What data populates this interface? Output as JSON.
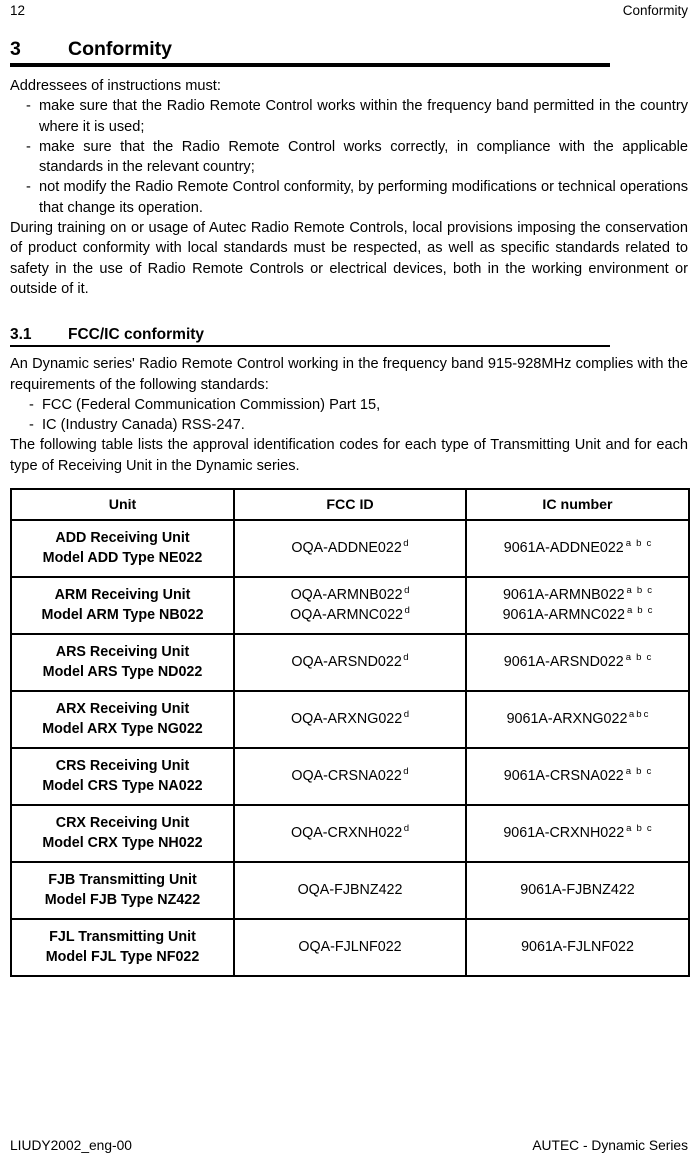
{
  "running_head": {
    "page_number": "12",
    "section_name": "Conformity"
  },
  "section_3": {
    "number": "3",
    "title": "Conformity",
    "intro": "Addressees of instructions must:",
    "bullets": [
      "make sure that the Radio Remote Control works within the frequency band permitted in the country where it is used;",
      "make sure that the Radio Remote Control works correctly, in compliance with the applicable standards in the relevant country;",
      "not modify the Radio Remote Control conformity, by performing modifications or technical operations that change its operation."
    ],
    "closing_paragraph": "During training on or usage of Autec Radio Remote Controls, local provisions imposing the conservation of product conformity with local standards must be respected, as well as specific standards related to safety in the use of Radio Remote Controls or electrical devices, both in the working environment or outside of it."
  },
  "section_3_1": {
    "number": "3.1",
    "title": "FCC/IC conformity",
    "intro": "An Dynamic series' Radio Remote Control working in the frequency band 915-928MHz complies with the requirements of the following standards:",
    "standards": [
      "FCC (Federal Communication Commission) Part 15,",
      "IC (Industry Canada) RSS-247."
    ],
    "table_lead_in": "The following table lists the approval identification codes for each type of Transmitting Unit and for each type of Receiving Unit in the Dynamic series."
  },
  "codes_table": {
    "headers": [
      "Unit",
      "FCC ID",
      "IC number"
    ],
    "rows": [
      {
        "unit_line1": "ADD Receiving Unit",
        "unit_line2": "Model ADD  Type NE022",
        "fcc_ids": [
          {
            "code": "OQA-ADDNE022",
            "notes": [
              "d"
            ]
          }
        ],
        "ic_numbers": [
          {
            "code": "9061A-ADDNE022",
            "notes": [
              "a",
              "b",
              "c"
            ],
            "spacing": "wide"
          }
        ]
      },
      {
        "unit_line1": "ARM Receiving Unit",
        "unit_line2": "Model ARM  Type NB022",
        "fcc_ids": [
          {
            "code": "OQA-ARMNB022",
            "notes": [
              "d"
            ]
          },
          {
            "code": "OQA-ARMNC022",
            "notes": [
              "d"
            ]
          }
        ],
        "ic_numbers": [
          {
            "code": "9061A-ARMNB022",
            "notes": [
              "a",
              "b",
              "c"
            ],
            "spacing": "wide"
          },
          {
            "code": "9061A-ARMNC022",
            "notes": [
              "a",
              "b",
              "c"
            ],
            "spacing": "wide"
          }
        ]
      },
      {
        "unit_line1": "ARS Receiving Unit",
        "unit_line2": "Model ARS  Type ND022",
        "fcc_ids": [
          {
            "code": "OQA-ARSND022",
            "notes": [
              "d"
            ]
          }
        ],
        "ic_numbers": [
          {
            "code": "9061A-ARSND022",
            "notes": [
              "a",
              "b",
              "c"
            ],
            "spacing": "wide"
          }
        ]
      },
      {
        "unit_line1": "ARX Receiving Unit",
        "unit_line2": "Model ARX  Type NG022",
        "fcc_ids": [
          {
            "code": "OQA-ARXNG022",
            "notes": [
              "d"
            ]
          }
        ],
        "ic_numbers": [
          {
            "code": "9061A-ARXNG022",
            "notes": [
              "a",
              "b",
              "c"
            ],
            "spacing": "narrow"
          }
        ]
      },
      {
        "unit_line1": "CRS Receiving Unit",
        "unit_line2": "Model CRS  Type NA022",
        "fcc_ids": [
          {
            "code": "OQA-CRSNA022",
            "notes": [
              "d"
            ]
          }
        ],
        "ic_numbers": [
          {
            "code": "9061A-CRSNA022",
            "notes": [
              "a",
              "b",
              "c"
            ],
            "spacing": "wide"
          }
        ]
      },
      {
        "unit_line1": "CRX Receiving Unit",
        "unit_line2": "Model CRX  Type NH022",
        "fcc_ids": [
          {
            "code": "OQA-CRXNH022",
            "notes": [
              "d"
            ]
          }
        ],
        "ic_numbers": [
          {
            "code": "9061A-CRXNH022",
            "notes": [
              "a",
              "b",
              "c"
            ],
            "spacing": "wide"
          }
        ]
      },
      {
        "unit_line1": "FJB Transmitting Unit",
        "unit_line2": "Model FJB  Type NZ422",
        "fcc_ids": [
          {
            "code": "OQA-FJBNZ422",
            "notes": []
          }
        ],
        "ic_numbers": [
          {
            "code": "9061A-FJBNZ422",
            "notes": []
          }
        ]
      },
      {
        "unit_line1": "FJL Transmitting Unit",
        "unit_line2": "Model FJL  Type NF022",
        "fcc_ids": [
          {
            "code": "OQA-FJLNF022",
            "notes": []
          }
        ],
        "ic_numbers": [
          {
            "code": "9061A-FJLNF022",
            "notes": []
          }
        ]
      }
    ]
  },
  "footer": {
    "document_code": "LIUDY2002_eng-00",
    "product_line": "AUTEC - Dynamic Series"
  }
}
